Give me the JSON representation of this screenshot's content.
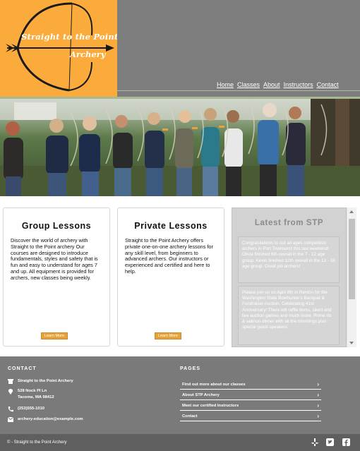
{
  "logo": {
    "line1": "Straight to the Point",
    "line2": "Archery"
  },
  "nav": [
    "Home",
    "Classes",
    "About",
    "Instructors",
    "Contact"
  ],
  "cards": [
    {
      "title": "Group Lessons",
      "body": "Discover the world of archery with Straight to the Point archery Our courses are designed to introduce fundamentals, styles and safety that is fun and easy to understand for ages 7 and up. All equipment is provided for archers, new classes being weekly.",
      "button": "Learn More"
    },
    {
      "title": "Private Lessons",
      "body": "Straight to the Point Archery offers private one-on-one archery lessons for any skill level, from beginners to advanced archers. Our instructors or experienced and certified and here to help.",
      "button": "Learn More"
    }
  ],
  "news": {
    "title": "Latest from STP",
    "items": [
      "Congratulations to our all ages competition archers in Port Townsend this last weekend! Olivia finished 6th overall in the 7 - 12 age group. Kevin finished 12th overall in the 13 - 18 age group. Great job archers!",
      "Please join us on April 8th in Renton for the Washington State Bowhunter's Banquet & Fundraiser Auction. Celebrating 41st Anniversary! There will raffle items, silent and live auction games and much more. Prime rib & salmon dinner with all the trimmings plus special guest speakers."
    ]
  },
  "footer": {
    "contact_heading": "CONTACT",
    "business": "Straight to the Point Archery",
    "address1": "528 Nock Pl Ln",
    "address2": "Tacoma, WA 98412",
    "phone": "(253)555-1010",
    "email": "archery-education@example.com",
    "pages_heading": "PAGES",
    "links": [
      "Find out more about our classes",
      "About STP Archery",
      "Meet our certified Instructors",
      "Contact"
    ]
  },
  "copyright": "© - Straight to the Point Archery",
  "colors": {
    "accent_orange": "#fbab3c",
    "header_gray": "#7d7d7d",
    "footer_gray": "#7a7a7a",
    "bottom_bar": "#5f5f5f",
    "button_orange": "#e6a238"
  },
  "icons": [
    "bow-arrow-logo-icon",
    "building-icon",
    "location-pin-icon",
    "phone-icon",
    "email-icon",
    "chevron-right-icon",
    "yelp-icon",
    "twitter-icon",
    "facebook-icon"
  ]
}
